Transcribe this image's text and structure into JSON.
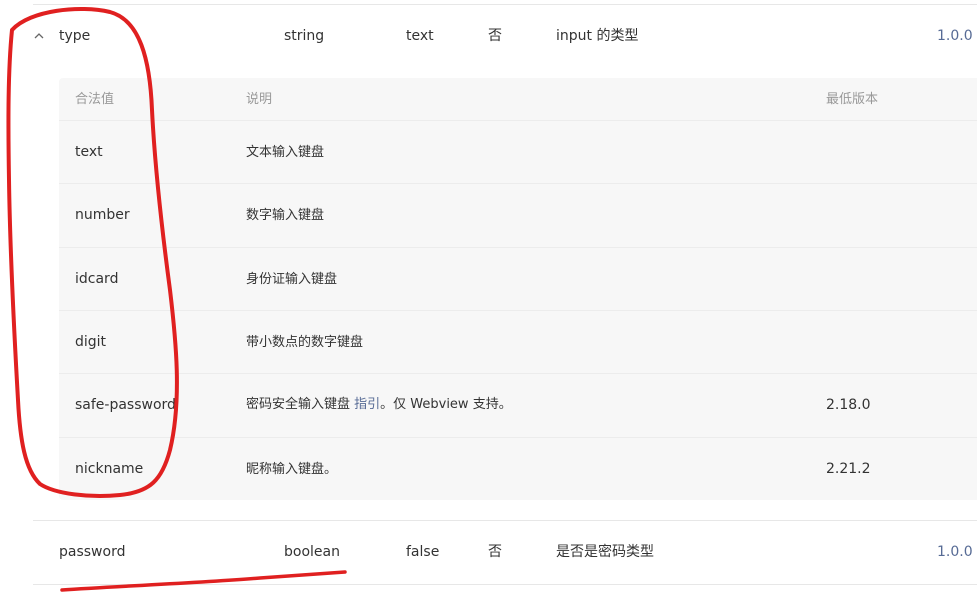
{
  "type_row": {
    "name": "type",
    "datatype": "string",
    "default": "text",
    "required": "否",
    "description": "input 的类型",
    "version": "1.0.0"
  },
  "sub_table": {
    "headers": [
      "合法值",
      "说明",
      "最低版本"
    ],
    "rows": [
      {
        "value": "text",
        "desc": "文本输入键盘",
        "version": ""
      },
      {
        "value": "number",
        "desc": "数字输入键盘",
        "version": ""
      },
      {
        "value": "idcard",
        "desc": "身份证输入键盘",
        "version": ""
      },
      {
        "value": "digit",
        "desc": "带小数点的数字键盘",
        "version": ""
      },
      {
        "value": "safe-password",
        "desc_before": "密码安全输入键盘 ",
        "desc_link": "指引",
        "desc_after": "。仅 Webview 支持。",
        "version": "2.18.0"
      },
      {
        "value": "nickname",
        "desc": "昵称输入键盘。",
        "version": "2.21.2"
      }
    ]
  },
  "password_row": {
    "name": "password",
    "datatype": "boolean",
    "default": "false",
    "required": "否",
    "description": "是否是密码类型",
    "version": "1.0.0"
  },
  "colors": {
    "annotation": "#e02020",
    "version_text": "#576b95",
    "subtable_bg": "#f7f7f7"
  },
  "icons": {
    "expand_toggle": "chevron-up-icon"
  }
}
